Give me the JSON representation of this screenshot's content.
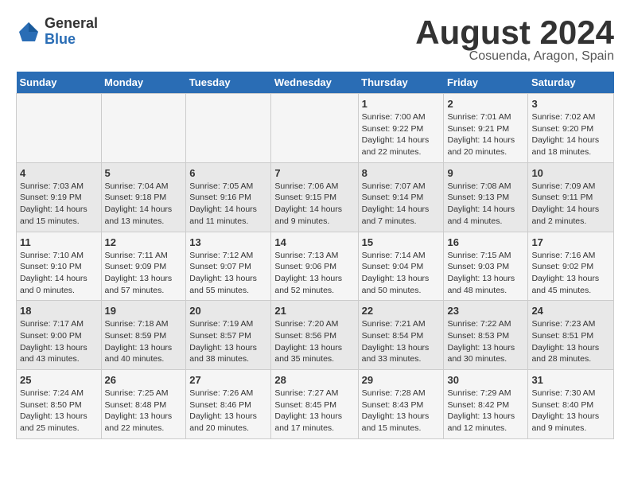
{
  "logo": {
    "general": "General",
    "blue": "Blue"
  },
  "title": "August 2024",
  "subtitle": "Cosuenda, Aragon, Spain",
  "days_of_week": [
    "Sunday",
    "Monday",
    "Tuesday",
    "Wednesday",
    "Thursday",
    "Friday",
    "Saturday"
  ],
  "weeks": [
    [
      {
        "day": "",
        "info": ""
      },
      {
        "day": "",
        "info": ""
      },
      {
        "day": "",
        "info": ""
      },
      {
        "day": "",
        "info": ""
      },
      {
        "day": "1",
        "info": "Sunrise: 7:00 AM\nSunset: 9:22 PM\nDaylight: 14 hours\nand 22 minutes."
      },
      {
        "day": "2",
        "info": "Sunrise: 7:01 AM\nSunset: 9:21 PM\nDaylight: 14 hours\nand 20 minutes."
      },
      {
        "day": "3",
        "info": "Sunrise: 7:02 AM\nSunset: 9:20 PM\nDaylight: 14 hours\nand 18 minutes."
      }
    ],
    [
      {
        "day": "4",
        "info": "Sunrise: 7:03 AM\nSunset: 9:19 PM\nDaylight: 14 hours\nand 15 minutes."
      },
      {
        "day": "5",
        "info": "Sunrise: 7:04 AM\nSunset: 9:18 PM\nDaylight: 14 hours\nand 13 minutes."
      },
      {
        "day": "6",
        "info": "Sunrise: 7:05 AM\nSunset: 9:16 PM\nDaylight: 14 hours\nand 11 minutes."
      },
      {
        "day": "7",
        "info": "Sunrise: 7:06 AM\nSunset: 9:15 PM\nDaylight: 14 hours\nand 9 minutes."
      },
      {
        "day": "8",
        "info": "Sunrise: 7:07 AM\nSunset: 9:14 PM\nDaylight: 14 hours\nand 7 minutes."
      },
      {
        "day": "9",
        "info": "Sunrise: 7:08 AM\nSunset: 9:13 PM\nDaylight: 14 hours\nand 4 minutes."
      },
      {
        "day": "10",
        "info": "Sunrise: 7:09 AM\nSunset: 9:11 PM\nDaylight: 14 hours\nand 2 minutes."
      }
    ],
    [
      {
        "day": "11",
        "info": "Sunrise: 7:10 AM\nSunset: 9:10 PM\nDaylight: 14 hours\nand 0 minutes."
      },
      {
        "day": "12",
        "info": "Sunrise: 7:11 AM\nSunset: 9:09 PM\nDaylight: 13 hours\nand 57 minutes."
      },
      {
        "day": "13",
        "info": "Sunrise: 7:12 AM\nSunset: 9:07 PM\nDaylight: 13 hours\nand 55 minutes."
      },
      {
        "day": "14",
        "info": "Sunrise: 7:13 AM\nSunset: 9:06 PM\nDaylight: 13 hours\nand 52 minutes."
      },
      {
        "day": "15",
        "info": "Sunrise: 7:14 AM\nSunset: 9:04 PM\nDaylight: 13 hours\nand 50 minutes."
      },
      {
        "day": "16",
        "info": "Sunrise: 7:15 AM\nSunset: 9:03 PM\nDaylight: 13 hours\nand 48 minutes."
      },
      {
        "day": "17",
        "info": "Sunrise: 7:16 AM\nSunset: 9:02 PM\nDaylight: 13 hours\nand 45 minutes."
      }
    ],
    [
      {
        "day": "18",
        "info": "Sunrise: 7:17 AM\nSunset: 9:00 PM\nDaylight: 13 hours\nand 43 minutes."
      },
      {
        "day": "19",
        "info": "Sunrise: 7:18 AM\nSunset: 8:59 PM\nDaylight: 13 hours\nand 40 minutes."
      },
      {
        "day": "20",
        "info": "Sunrise: 7:19 AM\nSunset: 8:57 PM\nDaylight: 13 hours\nand 38 minutes."
      },
      {
        "day": "21",
        "info": "Sunrise: 7:20 AM\nSunset: 8:56 PM\nDaylight: 13 hours\nand 35 minutes."
      },
      {
        "day": "22",
        "info": "Sunrise: 7:21 AM\nSunset: 8:54 PM\nDaylight: 13 hours\nand 33 minutes."
      },
      {
        "day": "23",
        "info": "Sunrise: 7:22 AM\nSunset: 8:53 PM\nDaylight: 13 hours\nand 30 minutes."
      },
      {
        "day": "24",
        "info": "Sunrise: 7:23 AM\nSunset: 8:51 PM\nDaylight: 13 hours\nand 28 minutes."
      }
    ],
    [
      {
        "day": "25",
        "info": "Sunrise: 7:24 AM\nSunset: 8:50 PM\nDaylight: 13 hours\nand 25 minutes."
      },
      {
        "day": "26",
        "info": "Sunrise: 7:25 AM\nSunset: 8:48 PM\nDaylight: 13 hours\nand 22 minutes."
      },
      {
        "day": "27",
        "info": "Sunrise: 7:26 AM\nSunset: 8:46 PM\nDaylight: 13 hours\nand 20 minutes."
      },
      {
        "day": "28",
        "info": "Sunrise: 7:27 AM\nSunset: 8:45 PM\nDaylight: 13 hours\nand 17 minutes."
      },
      {
        "day": "29",
        "info": "Sunrise: 7:28 AM\nSunset: 8:43 PM\nDaylight: 13 hours\nand 15 minutes."
      },
      {
        "day": "30",
        "info": "Sunrise: 7:29 AM\nSunset: 8:42 PM\nDaylight: 13 hours\nand 12 minutes."
      },
      {
        "day": "31",
        "info": "Sunrise: 7:30 AM\nSunset: 8:40 PM\nDaylight: 13 hours\nand 9 minutes."
      }
    ]
  ]
}
